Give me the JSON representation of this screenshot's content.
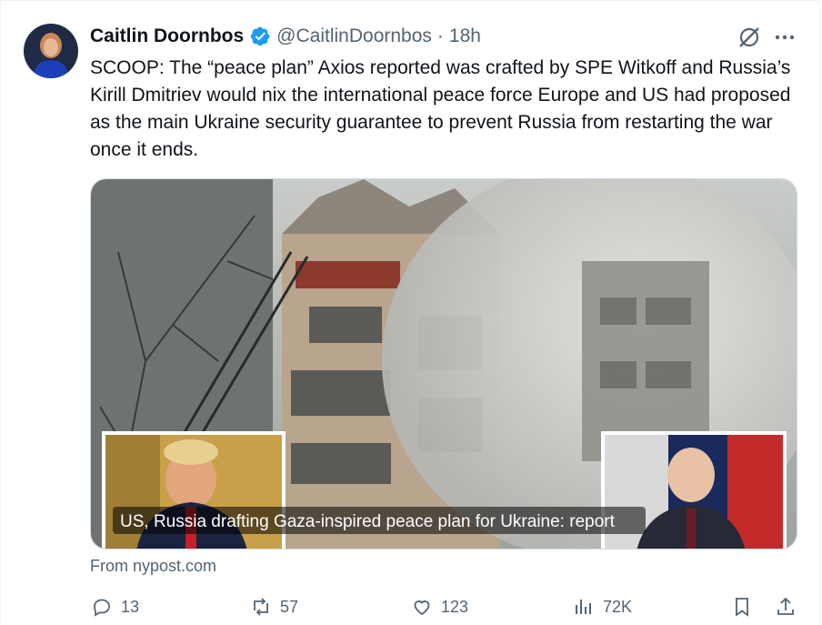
{
  "tweet": {
    "author_name": "Caitlin Doornbos",
    "handle": "@CaitlinDoornbos",
    "separator": "·",
    "time": "18h",
    "text": "SCOOP: The “peace plan” Axios reported was crafted by SPE Witkoff and Russia’s Kirill Dmitriev would nix the international peace force Europe and US had proposed as the main Ukraine security guarantee to prevent Russia from restarting the war once it ends."
  },
  "card": {
    "headline": "US, Russia drafting Gaza-inspired peace plan for Ukraine: report",
    "source": "From nypost.com"
  },
  "actions": {
    "replies": "13",
    "reposts": "57",
    "likes": "123",
    "views": "72K"
  },
  "colors": {
    "text": "#0f1419",
    "secondary": "#536471",
    "verified": "#1d9bf0",
    "border": "#cfd9de"
  },
  "icons": [
    "verified-badge-icon",
    "grok-icon",
    "more-icon",
    "reply-icon",
    "repost-icon",
    "like-icon",
    "views-icon",
    "bookmark-icon",
    "share-icon"
  ]
}
